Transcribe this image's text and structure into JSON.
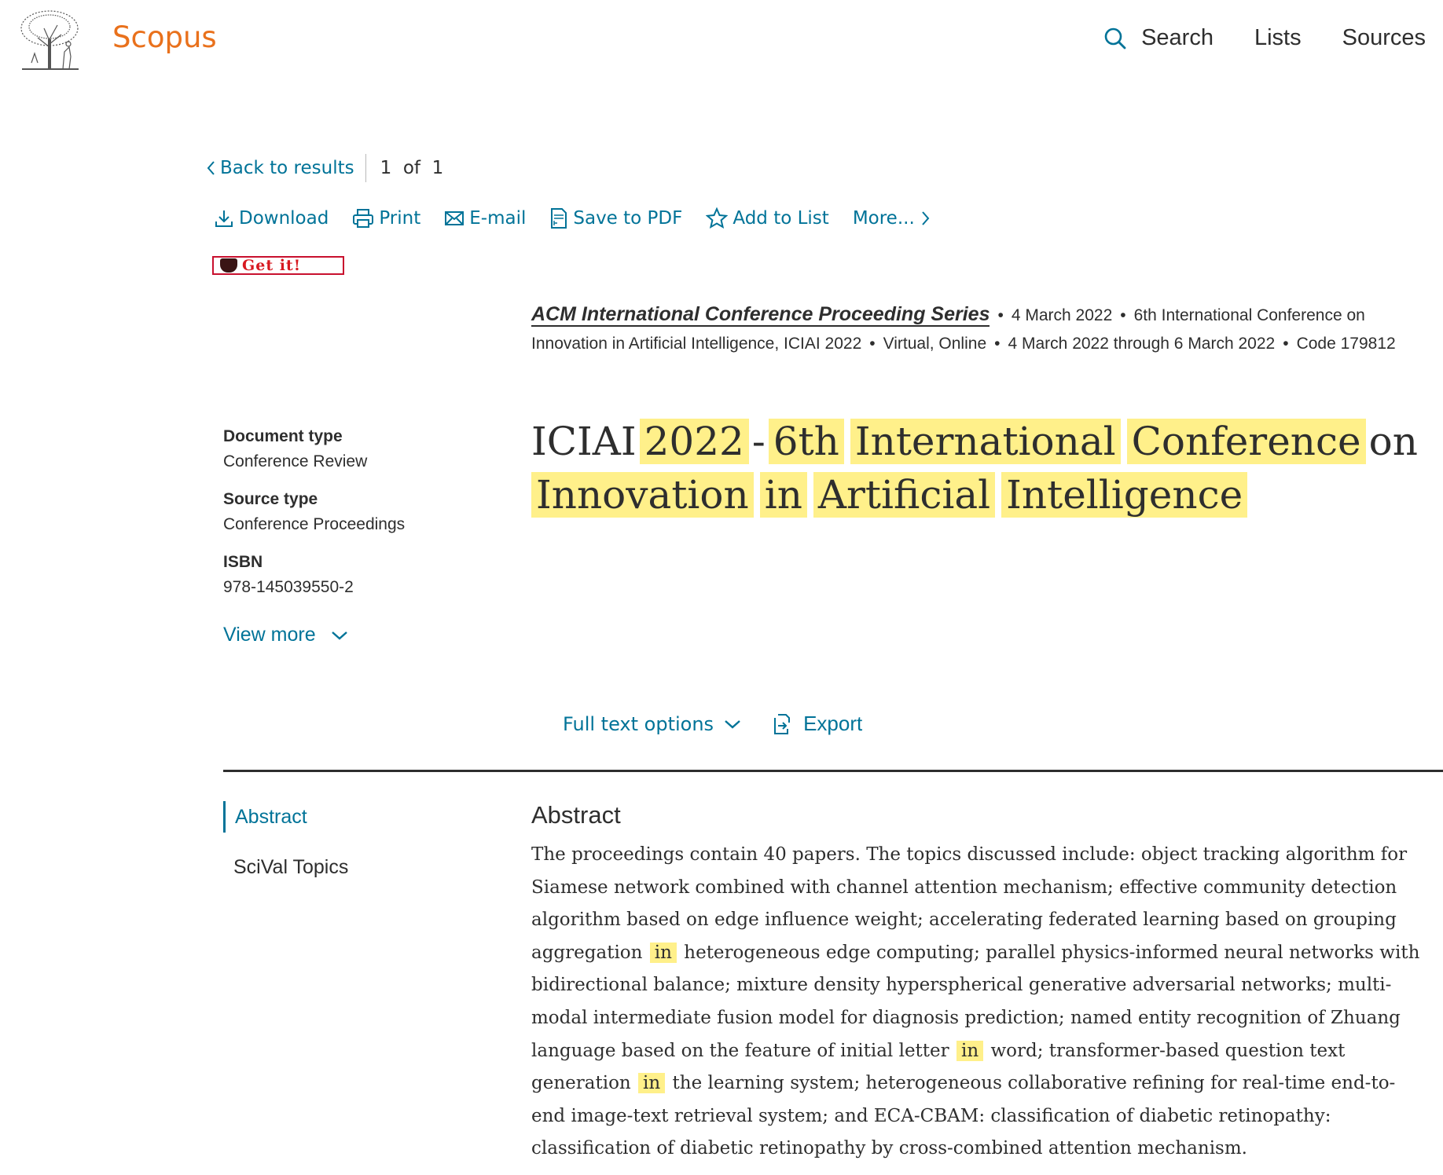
{
  "header": {
    "brand": "Scopus",
    "nav": {
      "search": "Search",
      "lists": "Lists",
      "sources": "Sources"
    }
  },
  "breadcrumb": {
    "back": "Back to results",
    "pager": "1  of  1"
  },
  "toolbar": {
    "download": "Download",
    "print": "Print",
    "email": "E-mail",
    "save_pdf": "Save to PDF",
    "add_list": "Add to List",
    "more": "More..."
  },
  "getit": "Get it!",
  "source": {
    "title": "ACM International Conference Proceeding Series",
    "date": "4 March 2022",
    "conference": "6th International Conference on Innovation in Artificial Intelligence, ICIAI 2022",
    "location": "Virtual, Online",
    "dates": "4 March 2022 through 6 March 2022",
    "code": "Code 179812"
  },
  "meta": {
    "doc_type_label": "Document type",
    "doc_type_value": "Conference Review",
    "source_type_label": "Source type",
    "source_type_value": "Conference Proceedings",
    "isbn_label": "ISBN",
    "isbn_value": "978-145039550-2",
    "view_more": "View more"
  },
  "title": {
    "w1": "ICIAI",
    "w2": "2022",
    "w3": "-",
    "w4": "6th",
    "w5": "International",
    "w6": "Conference",
    "w7": "on",
    "w8": "Innovation",
    "w9": "in",
    "w10": "Artificial",
    "w11": "Intelligence"
  },
  "actions": {
    "full_text": "Full text options",
    "export": "Export"
  },
  "sidenav": {
    "abstract": "Abstract",
    "topics": "SciVal Topics"
  },
  "abstract": {
    "heading": "Abstract",
    "p1": "The proceedings contain 40 papers. The topics discussed include: object tracking algorithm for Siamese network combined with channel attention mechanism; effective community detection algorithm based on edge influence weight; accelerating federated learning based on grouping aggregation",
    "hl1": "in",
    "p2": "heterogeneous edge computing; parallel physics-informed neural networks with bidirectional balance; mixture density hyperspherical generative adversarial networks; multi-modal intermediate fusion model for diagnosis prediction; named entity recognition of Zhuang language based on the feature of initial letter",
    "hl2": "in",
    "p3": "word; transformer-based question text generation",
    "hl3": "in",
    "p4": "the learning system; heterogeneous collaborative refining for real-time end-to-end image-text retrieval system; and ECA-CBAM: classification of diabetic retinopathy: classification of diabetic retinopathy by cross-combined attention mechanism."
  },
  "colors": {
    "link": "#007398",
    "brand": "#e9711c",
    "highlight": "#fff08a",
    "getit": "#d71920"
  }
}
